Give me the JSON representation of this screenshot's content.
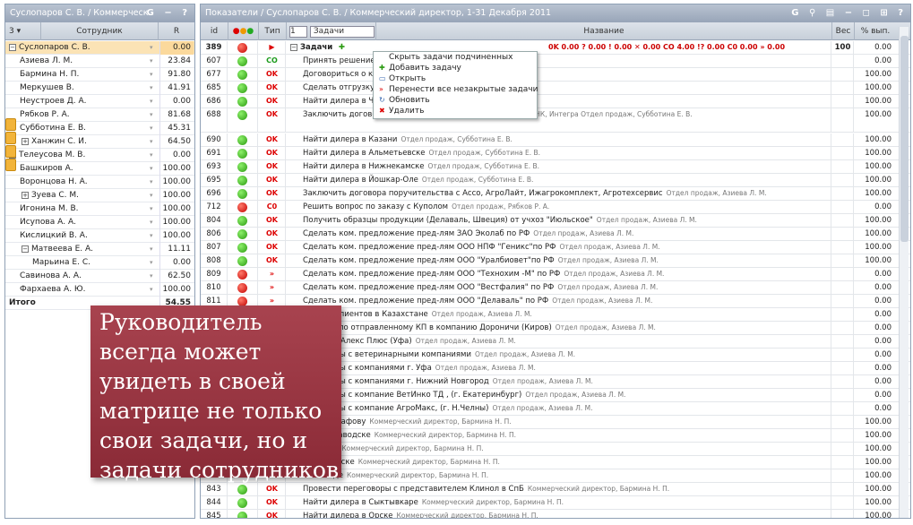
{
  "left_panel": {
    "title": "Суслопаров С. В. / Коммерческ",
    "title_buttons": "G − ?",
    "header": {
      "level": "3",
      "employee": "Сотрудник",
      "r": "R"
    },
    "rows": [
      {
        "name": "Суслопаров С. В.",
        "value": "0.00",
        "expander": "−",
        "selected": true
      },
      {
        "name": "Азиева Л. М.",
        "value": "23.84"
      },
      {
        "name": "Бармина Н. П.",
        "value": "91.80"
      },
      {
        "name": "Меркушев В.",
        "value": "41.91"
      },
      {
        "name": "Неустроев Д. А.",
        "value": "0.00"
      },
      {
        "name": "Рябков Р. А.",
        "value": "81.68"
      },
      {
        "name": "Субботина Е. В.",
        "value": "45.31"
      },
      {
        "name": "Ханжин С. И.",
        "value": "64.50",
        "expander": "+"
      },
      {
        "name": "Телеусова М. В.",
        "value": "0.00",
        "expander": "−"
      },
      {
        "name": "Башкиров А.",
        "value": "100.00"
      },
      {
        "name": "Воронцова Н. А.",
        "value": "100.00"
      },
      {
        "name": "Зуева С. М.",
        "value": "100.00",
        "expander": "+"
      },
      {
        "name": "Игонина М. В.",
        "value": "100.00"
      },
      {
        "name": "Исупова А. А.",
        "value": "100.00"
      },
      {
        "name": "Кислицкий В. А.",
        "value": "100.00"
      },
      {
        "name": "Матвеева Е. А.",
        "value": "11.11",
        "expander": "−"
      },
      {
        "name": "Марьина Е. С.",
        "value": "0.00"
      },
      {
        "name": "Савинова А. А.",
        "value": "62.50"
      },
      {
        "name": "Фархаева А. Ю.",
        "value": "100.00"
      }
    ],
    "total_label": "Итого",
    "total_value": "54.55"
  },
  "right_panel": {
    "title": "Показатели / Суслопаров С. В. / Коммерческий директор, 1-31 Декабря 2011",
    "title_buttons": "G ⚲ ▤ − ◻ ⊞ ?",
    "header": {
      "id": "id",
      "type": "Тип",
      "level": "1",
      "filter": "Задачи",
      "name": "Название",
      "weight": "Вес",
      "pct": "% вып."
    },
    "summary": {
      "id": "389",
      "label": "Задачи",
      "stats": "0K 0.00   ? 0.00   ! 0.00   ✕ 0.00   CO 4.00   !? 0.00   C0 0.00   » 0.00",
      "weight": "100",
      "pct": "0.00"
    },
    "rows": [
      {
        "id": "607",
        "status": "green",
        "type": "CO",
        "title": "Принять решение",
        "owner": "",
        "pct": "0.00"
      },
      {
        "id": "677",
        "status": "green",
        "type": "OK",
        "title": "Договориться о к",
        "owner": "Коммерческий директор, Бармина Н. П.",
        "pct": "100.00"
      },
      {
        "id": "685",
        "status": "green",
        "type": "OK",
        "title": "Сделать отгрузку",
        "owner": "Коммерческий директор, Бармина Н. П.",
        "pct": "100.00"
      },
      {
        "id": "686",
        "status": "green",
        "type": "OK",
        "title": "Найти дилера в Че",
        "owner": "",
        "pct": "100.00"
      },
      {
        "id": "688",
        "status": "green",
        "type": "OK",
        "title": "Заключить договор",
        "owner": "...С-Профи, СТК, Пав-Сервис, ТехноросТ, АНК, Интегра Отдел продаж, Субботина Е. В.",
        "pct": "100.00",
        "tall": true
      },
      {
        "id": "690",
        "status": "green",
        "type": "OK",
        "title": "Найти дилера в Казани",
        "owner": "Отдел продаж, Субботина Е. В.",
        "pct": "100.00"
      },
      {
        "id": "691",
        "status": "green",
        "type": "OK",
        "title": "Найти дилера в Альметьевске",
        "owner": "Отдел продаж, Субботина Е. В.",
        "pct": "100.00"
      },
      {
        "id": "693",
        "status": "green",
        "type": "OK",
        "title": "Найти дилера в Нижнекамске",
        "owner": "Отдел продаж, Субботина Е. В.",
        "pct": "100.00"
      },
      {
        "id": "695",
        "status": "green",
        "type": "OK",
        "title": "Найти дилера в Йошкар-Оле",
        "owner": "Отдел продаж, Субботина Е. В.",
        "pct": "100.00"
      },
      {
        "id": "696",
        "status": "green",
        "type": "OK",
        "title": "Заключить договора поручительства с Ассо, АгроЛайт, Ижагрокомплект, Агротехсервис",
        "owner": "Отдел продаж, Азиева Л. М.",
        "pct": "100.00"
      },
      {
        "id": "712",
        "status": "red",
        "type": "C0",
        "title": "Решить вопрос по заказу с Куполом",
        "owner": "Отдел продаж, Рябков Р. А.",
        "pct": "0.00"
      },
      {
        "id": "804",
        "status": "green",
        "type": "OK",
        "title": "Получить образцы продукции (Делаваль, Швеция) от учхоз \"Июльское\"",
        "owner": "Отдел продаж, Азиева Л. М.",
        "pct": "100.00"
      },
      {
        "id": "806",
        "status": "green",
        "type": "OK",
        "title": "Сделать ком. предложение пред-лям ЗАО Эколаб по РФ",
        "owner": "Отдел продаж, Азиева Л. М.",
        "pct": "100.00"
      },
      {
        "id": "807",
        "status": "green",
        "type": "OK",
        "title": "Сделать ком. предложение пред-лям ООО НПФ \"Геникс\"по РФ",
        "owner": "Отдел продаж, Азиева Л. М.",
        "pct": "100.00"
      },
      {
        "id": "808",
        "status": "green",
        "type": "OK",
        "title": "Сделать ком. предложение пред-лям ООО \"Уралбиовет\"по РФ",
        "owner": "Отдел продаж, Азиева Л. М.",
        "pct": "100.00"
      },
      {
        "id": "809",
        "status": "red",
        "type": "»",
        "title": "Сделать ком. предложение пред-лям ООО \"Технохим -М\" по РФ",
        "owner": "Отдел продаж, Азиева Л. М.",
        "pct": "0.00"
      },
      {
        "id": "810",
        "status": "red",
        "type": "»",
        "title": "Сделать ком. предложение пред-лям ООО \"Вестфалия\" по РФ",
        "owner": "Отдел продаж, Азиева Л. М.",
        "pct": "0.00"
      },
      {
        "id": "811",
        "status": "red",
        "type": "»",
        "title": "Сделать ком. предложение пред-лям ООО \"Делаваль\" по РФ",
        "owner": "Отдел продаж, Азиева Л. М.",
        "pct": "0.00"
      },
      {
        "id": "",
        "status": "",
        "type": "",
        "title": "альных клиентов в Казахстане",
        "owner": "Отдел продаж, Азиева Л. М.",
        "pct": "0.00"
      },
      {
        "id": "",
        "status": "",
        "type": "",
        "title": "ультаты по отправленному КП в компанию Дороничи (Киров)",
        "owner": "Отдел продаж, Азиева Л. М.",
        "pct": "0.00"
      },
      {
        "id": "",
        "status": "",
        "type": "",
        "title": "говоры с Алекс Плюс (Уфа)",
        "owner": "Отдел продаж, Азиева Л. М.",
        "pct": "0.00"
      },
      {
        "id": "",
        "status": "",
        "type": "",
        "title": "ереговоры с ветеринарными компаниями",
        "owner": "Отдел продаж, Азиева Л. М.",
        "pct": "0.00"
      },
      {
        "id": "",
        "status": "",
        "type": "",
        "title": "ереговоры с компаниями г. Уфа",
        "owner": "Отдел продаж, Азиева Л. М.",
        "pct": "0.00"
      },
      {
        "id": "",
        "status": "",
        "type": "",
        "title": "ереговоры с компаниями г. Нижний Новгород",
        "owner": "Отдел продаж, Азиева Л. М.",
        "pct": "0.00"
      },
      {
        "id": "",
        "status": "",
        "type": "",
        "title": "ереговоры с компание ВетИнко ТД , (г. Екатеринбург)",
        "owner": "Отдел продаж, Азиева Л. М.",
        "pct": "0.00"
      },
      {
        "id": "",
        "status": "",
        "type": "",
        "title": "ереговоры с компание АгроМакс, (г. Н.Челны)",
        "owner": "Отдел продаж, Азиева Л. М.",
        "pct": "0.00"
      },
      {
        "id": "",
        "status": "",
        "type": "",
        "title": "узку Евграфову",
        "owner": "Коммерческий директор, Бармина Н. П.",
        "pct": "100.00"
      },
      {
        "id": "",
        "status": "",
        "type": "",
        "title": "в Петрозаводске",
        "owner": "Коммерческий директор, Бармина Н. П.",
        "pct": "100.00"
      },
      {
        "id": "",
        "status": "",
        "type": "",
        "title": "в Пскове",
        "owner": "Коммерческий директор, Бармина Н. П.",
        "pct": "100.00"
      },
      {
        "id": "",
        "status": "",
        "type": "",
        "title": "в Мурманске",
        "owner": "Коммерческий директор, Бармина Н. П.",
        "pct": "100.00"
      },
      {
        "id": "",
        "status": "",
        "type": "",
        "title": "в Вологде",
        "owner": "Коммерческий директор, Бармина Н. П.",
        "pct": "100.00"
      },
      {
        "id": "843",
        "status": "green",
        "type": "OK",
        "title": "Провести переговоры с представителем Клинол в СпБ",
        "owner": "Коммерческий директор, Бармина Н. П.",
        "pct": "100.00"
      },
      {
        "id": "844",
        "status": "green",
        "type": "OK",
        "title": "Найти дилера в Сыктывкаре",
        "owner": "Коммерческий директор, Бармина Н. П.",
        "pct": "100.00"
      },
      {
        "id": "845",
        "status": "green",
        "type": "OK",
        "title": "Найти дилера в Орске",
        "owner": "Коммерческий директор, Бармина Н. П.",
        "pct": "100.00"
      }
    ]
  },
  "context_menu": [
    {
      "icon": "",
      "color": "#000",
      "label": "Скрыть задачи подчиненных"
    },
    {
      "icon": "✚",
      "color": "#2a9a10",
      "label": "Добавить задачу"
    },
    {
      "icon": "▭",
      "color": "#3a6ab0",
      "label": "Открыть"
    },
    {
      "icon": "»",
      "color": "#d00",
      "label": "Перенести все незакрытые задачи"
    },
    {
      "icon": "↻",
      "color": "#3a6ab0",
      "label": "Обновить"
    },
    {
      "icon": "✖",
      "color": "#d00",
      "label": "Удалить"
    }
  ],
  "overlay_text": "Руководитель всегда может увидеть в своей матрице не только свои  задачи, но и задачи сотрудников"
}
